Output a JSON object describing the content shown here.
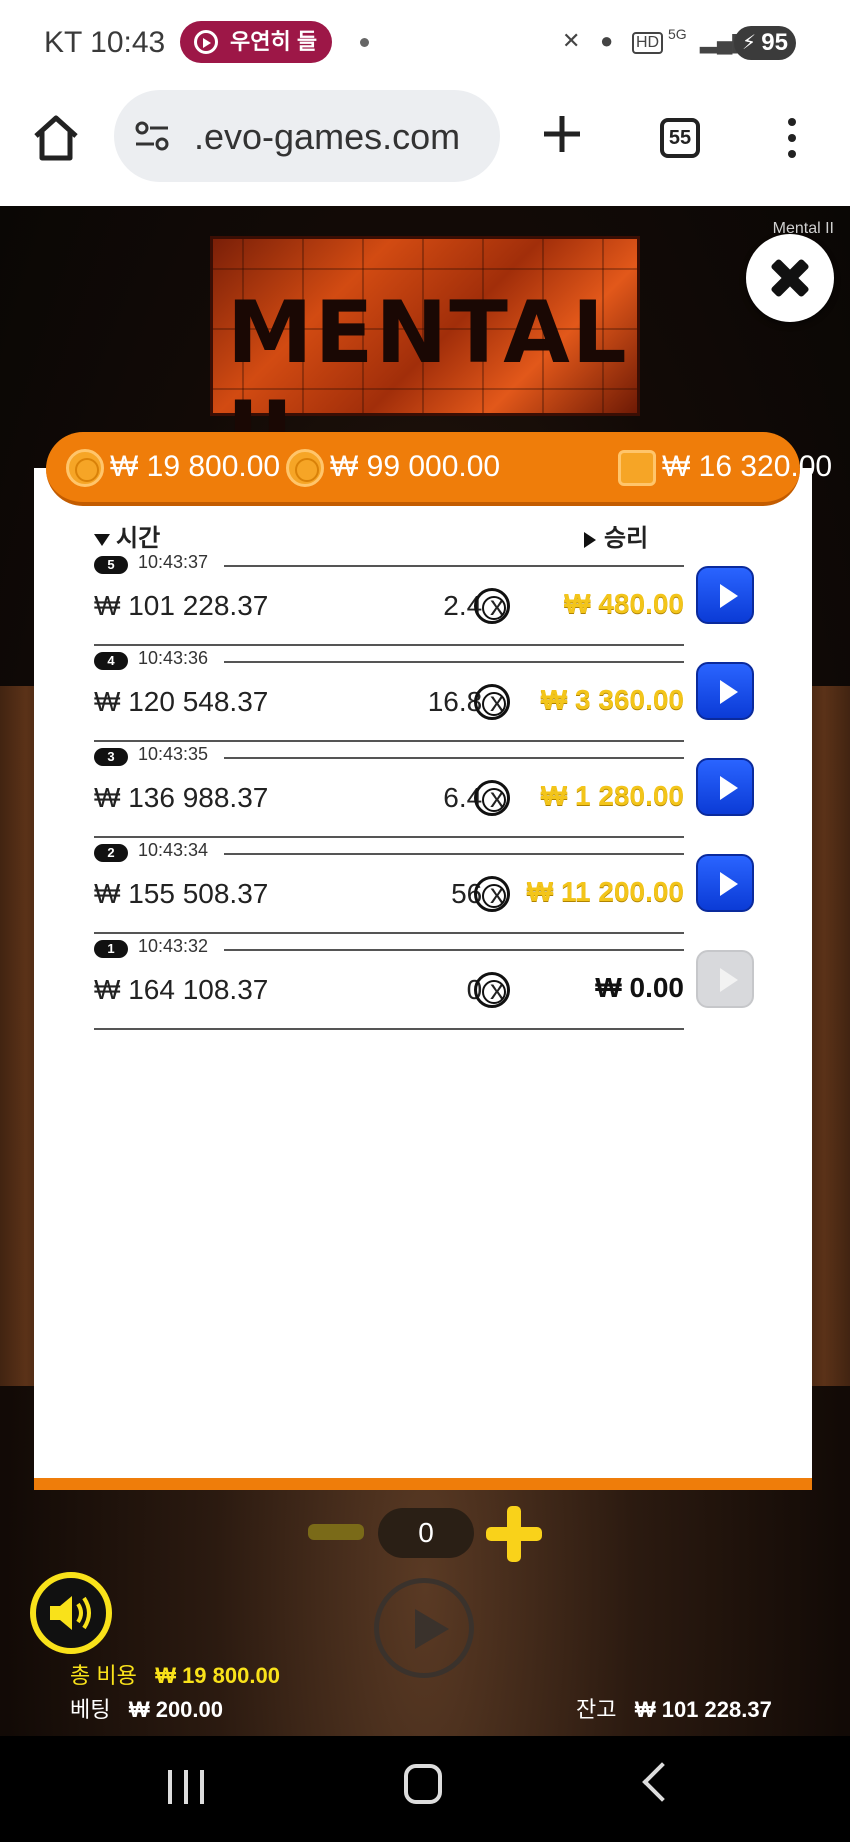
{
  "status_bar": {
    "carrier_time": "KT 10:43",
    "notification_label": "우연히 들",
    "battery": "95"
  },
  "browser": {
    "url": ".evo-games.com",
    "tab_count": "55"
  },
  "game": {
    "tag": "Mental II",
    "logo_text": "MENTAL II"
  },
  "header": {
    "total_cost": "₩ 19 800.00",
    "max_value": "₩ 99 000.00",
    "wallet": "₩ 16 320.00"
  },
  "history": {
    "col_time": "시간",
    "col_win": "승리",
    "rows": [
      {
        "round": "5",
        "time": "10:43:37",
        "balance": "₩ 101 228.37",
        "multiplier": "2.4 x",
        "win": "₩ 480.00"
      },
      {
        "round": "4",
        "time": "10:43:36",
        "balance": "₩ 120 548.37",
        "multiplier": "16.8 x",
        "win": "₩ 3 360.00"
      },
      {
        "round": "3",
        "time": "10:43:35",
        "balance": "₩ 136 988.37",
        "multiplier": "6.4 x",
        "win": "₩ 1 280.00"
      },
      {
        "round": "2",
        "time": "10:43:34",
        "balance": "₩ 155 508.37",
        "multiplier": "56 x",
        "win": "₩ 11 200.00"
      },
      {
        "round": "1",
        "time": "10:43:32",
        "balance": "₩ 164 108.37",
        "multiplier": "0 x",
        "win": "₩ 0.00"
      }
    ]
  },
  "controls": {
    "count": "0"
  },
  "footer": {
    "total_cost_label": "총 비용",
    "total_cost_value": "₩ 19 800.00",
    "bet_label": "베팅",
    "bet_value": "₩ 200.00",
    "balance_label": "잔고",
    "balance_value": "₩ 101 228.37"
  },
  "colors": {
    "accent_orange": "#ef7d0a",
    "win_gold": "#f3c51a",
    "replay_blue": "#1550f0",
    "footer_yellow": "#f9e21a"
  }
}
